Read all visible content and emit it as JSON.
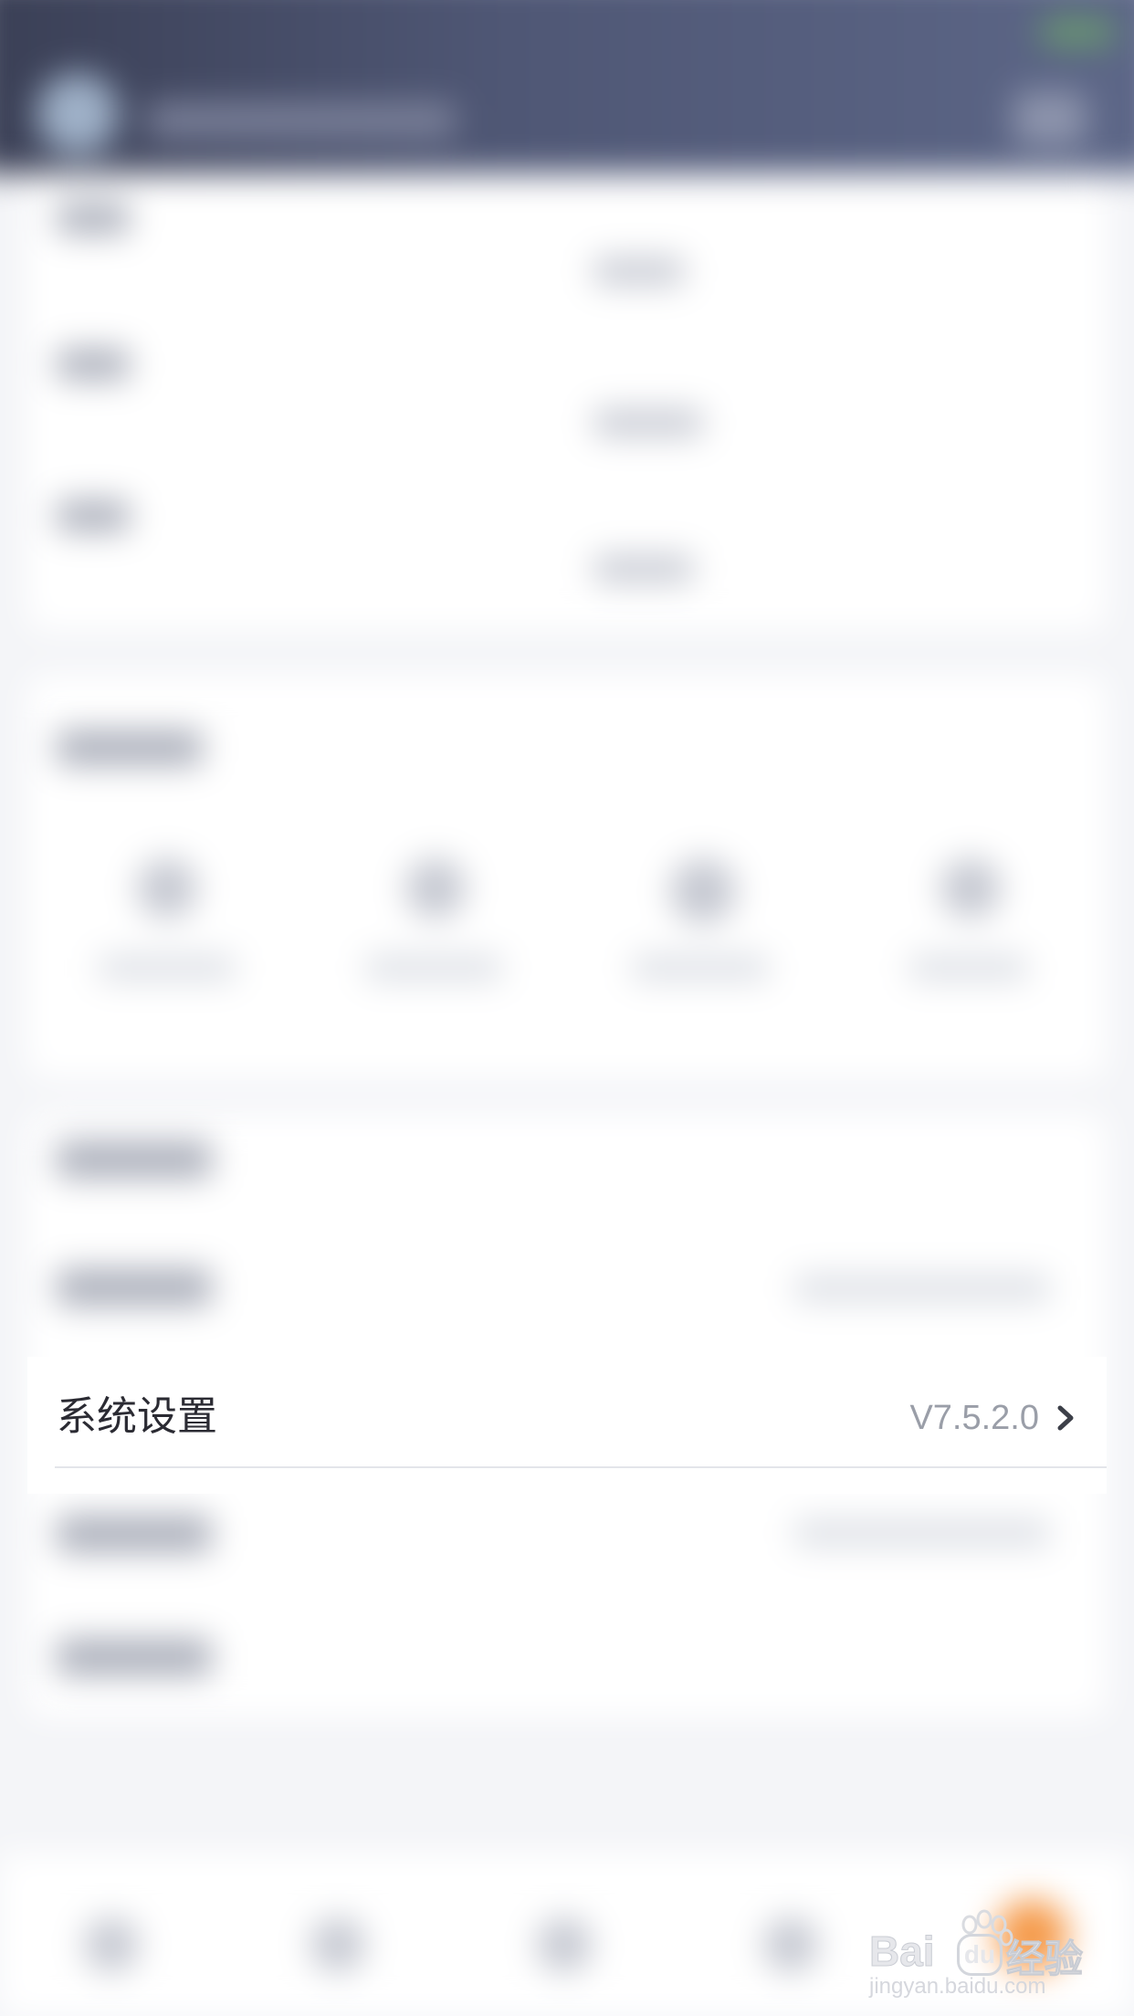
{
  "settings_row": {
    "label": "系统设置",
    "version": "V7.5.2.0"
  },
  "watermark": {
    "brand_prefix": "Bai",
    "brand_suffix": "经验",
    "url": "jingyan.baidu.com"
  },
  "colors": {
    "header_dark": "#3a3f55",
    "header_mid": "#5d6788",
    "background": "#f4f5f8",
    "row_text": "#2b2b33",
    "version_text": "#9a9ea8",
    "accent_orange": "#f59a4a"
  }
}
